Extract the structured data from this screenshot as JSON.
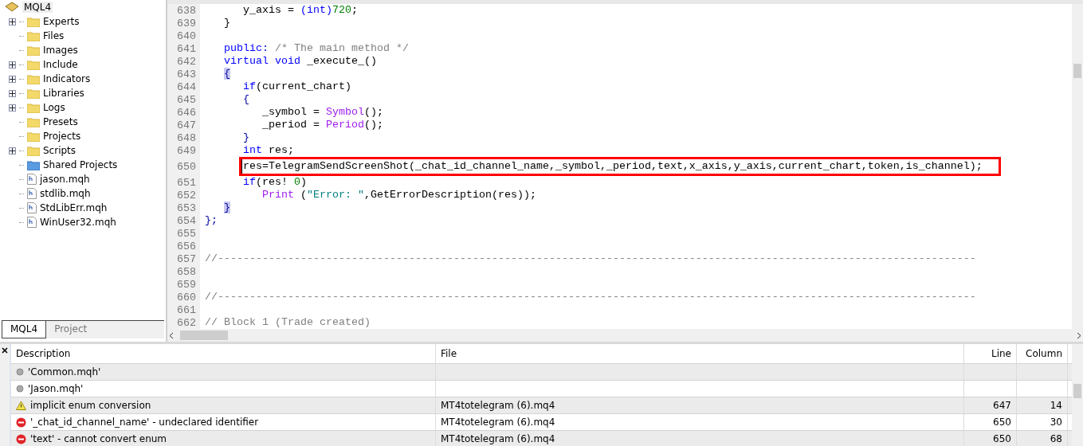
{
  "navigator": {
    "root": "MQL4",
    "items": [
      {
        "label": "Experts",
        "kind": "folder",
        "expandable": true
      },
      {
        "label": "Files",
        "kind": "folder",
        "expandable": false
      },
      {
        "label": "Images",
        "kind": "folder",
        "expandable": false
      },
      {
        "label": "Include",
        "kind": "folder",
        "expandable": true
      },
      {
        "label": "Indicators",
        "kind": "folder",
        "expandable": true
      },
      {
        "label": "Libraries",
        "kind": "folder",
        "expandable": true
      },
      {
        "label": "Logs",
        "kind": "folder",
        "expandable": true
      },
      {
        "label": "Presets",
        "kind": "folder",
        "expandable": false
      },
      {
        "label": "Projects",
        "kind": "folder",
        "expandable": false
      },
      {
        "label": "Scripts",
        "kind": "folder",
        "expandable": true
      },
      {
        "label": "Shared Projects",
        "kind": "shared",
        "expandable": false
      },
      {
        "label": "jason.mqh",
        "kind": "header",
        "expandable": false
      },
      {
        "label": "stdlib.mqh",
        "kind": "header",
        "expandable": false
      },
      {
        "label": "StdLibErr.mqh",
        "kind": "header",
        "expandable": false
      },
      {
        "label": "WinUser32.mqh",
        "kind": "header",
        "expandable": false
      }
    ],
    "tabs": [
      {
        "label": "MQL4",
        "selected": true
      },
      {
        "label": "Project",
        "selected": false
      }
    ]
  },
  "editor": {
    "lines": [
      {
        "number": "638",
        "tokens": [
          {
            "text": "      y_axis = ",
            "kind": "plain"
          },
          {
            "text": "(int)",
            "kind": "keyword"
          },
          {
            "text": "720",
            "kind": "number"
          },
          {
            "text": ";",
            "kind": "plain"
          }
        ]
      },
      {
        "number": "639",
        "tokens": [
          {
            "text": "   }",
            "kind": "plain"
          }
        ]
      },
      {
        "number": "640"
      },
      {
        "number": "641",
        "tokens": [
          {
            "text": "   public:",
            "kind": "keyword"
          },
          {
            "text": " /* The main method */",
            "kind": "comment"
          }
        ]
      },
      {
        "number": "642",
        "tokens": [
          {
            "text": "   virtual void",
            "kind": "keyword"
          },
          {
            "text": " _execute_()",
            "kind": "plain"
          }
        ]
      },
      {
        "number": "643",
        "tokens": [
          {
            "text": "   {",
            "kind": "brace",
            "match": true
          }
        ]
      },
      {
        "number": "644",
        "tokens": [
          {
            "text": "      if",
            "kind": "keyword"
          },
          {
            "text": "(current_chart)",
            "kind": "plain"
          }
        ]
      },
      {
        "number": "645",
        "tokens": [
          {
            "text": "      {",
            "kind": "brace",
            "match": false
          }
        ]
      },
      {
        "number": "646",
        "tokens": [
          {
            "text": "         _symbol = ",
            "kind": "plain"
          },
          {
            "text": "Symbol",
            "kind": "func"
          },
          {
            "text": "();",
            "kind": "plain"
          }
        ]
      },
      {
        "number": "647",
        "tokens": [
          {
            "text": "         _period = ",
            "kind": "plain"
          },
          {
            "text": "Period",
            "kind": "func"
          },
          {
            "text": "();",
            "kind": "plain"
          }
        ]
      },
      {
        "number": "648",
        "tokens": [
          {
            "text": "      }",
            "kind": "brace",
            "match": false
          }
        ]
      },
      {
        "number": "649",
        "tokens": [
          {
            "text": "      int",
            "kind": "keyword"
          },
          {
            "text": " res;",
            "kind": "plain"
          }
        ]
      },
      {
        "number": "650",
        "boxed": true,
        "tokens": [
          {
            "text": "res=TelegramSendScreenShot(_chat_id_channel_name,_symbol,_period,text,x_axis,y_axis,current_chart,token,is_channel);",
            "kind": "plain"
          }
        ]
      },
      {
        "number": "651",
        "tokens": [
          {
            "text": "      if",
            "kind": "keyword"
          },
          {
            "text": "(res! ",
            "kind": "plain"
          },
          {
            "text": "0",
            "kind": "number"
          },
          {
            "text": ")",
            "kind": "plain"
          }
        ]
      },
      {
        "number": "652",
        "tokens": [
          {
            "text": "         Print",
            "kind": "func"
          },
          {
            "text": " (",
            "kind": "plain"
          },
          {
            "text": "\"Error: \"",
            "kind": "string"
          },
          {
            "text": ",GetErrorDescription(res));",
            "kind": "plain"
          }
        ]
      },
      {
        "number": "653",
        "tokens": [
          {
            "text": "   }",
            "kind": "brace",
            "match": true
          }
        ]
      },
      {
        "number": "654",
        "tokens": [
          {
            "text": "};",
            "kind": "brace",
            "match": false
          }
        ]
      },
      {
        "number": "655"
      },
      {
        "number": "656"
      },
      {
        "number": "657",
        "tokens": [
          {
            "text": "//-----------------------------------------------------------------------------------------------------------------------",
            "kind": "comment"
          }
        ]
      },
      {
        "number": "658"
      },
      {
        "number": "659"
      },
      {
        "number": "660",
        "tokens": [
          {
            "text": "//-----------------------------------------------------------------------------------------------------------------------",
            "kind": "comment"
          }
        ]
      },
      {
        "number": "661"
      },
      {
        "number": "662",
        "tokens": [
          {
            "text": "// Block 1 (Trade created)",
            "kind": "comment"
          }
        ]
      }
    ]
  },
  "errors": {
    "columns": [
      "Description",
      "File",
      "Line",
      "Column"
    ],
    "rows": [
      {
        "kind": "info",
        "description": "'Common.mqh'"
      },
      {
        "kind": "info",
        "description": "'Jason.mqh'"
      },
      {
        "kind": "warning",
        "description": "implicit enum conversion",
        "file": "MT4totelegram (6).mq4",
        "line": "647",
        "column": "14"
      },
      {
        "kind": "error",
        "description": "'_chat_id_channel_name' - undeclared identifier",
        "file": "MT4totelegram (6).mq4",
        "line": "650",
        "column": "30"
      },
      {
        "kind": "error",
        "description": "'text' - cannot convert enum",
        "file": "MT4totelegram (6).mq4",
        "line": "650",
        "column": "68"
      }
    ]
  }
}
